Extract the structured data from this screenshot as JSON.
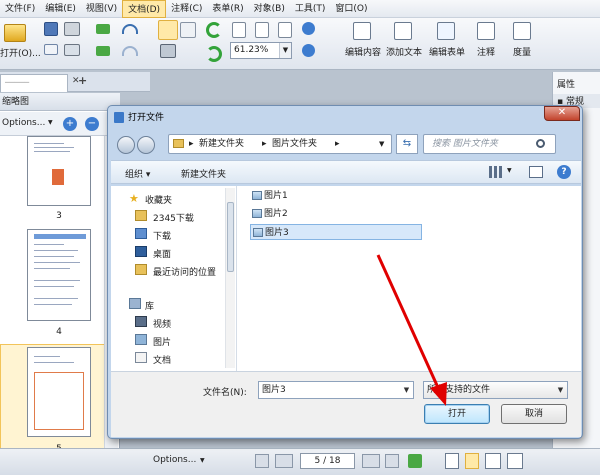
{
  "menu": [
    "文件(F)",
    "编辑(E)",
    "视图(V)",
    "文档(D)",
    "注释(C)",
    "表单(R)",
    "对象(B)",
    "工具(T)",
    "窗口(O)"
  ],
  "toolbar": {
    "open_label": "打开(O)...",
    "zoom_value": "61.23%",
    "edit_content": "编辑内容",
    "add_text": "添加文本",
    "edit_form": "编辑表单",
    "annotate": "注释",
    "measure": "度量"
  },
  "left_panel": {
    "title": "缩略图",
    "options": "Options...",
    "thumb_numbers": [
      "3",
      "4",
      "5"
    ]
  },
  "right_panel": {
    "header": "属性",
    "section": "常规"
  },
  "dialog": {
    "title": "打开文件",
    "breadcrumb": [
      "新建文件夹",
      "图片文件夹"
    ],
    "search_placeholder": "搜索 图片文件夹",
    "organize": "组织",
    "new_folder": "新建文件夹",
    "nav": {
      "favorites": "收藏夹",
      "items": [
        "2345下载",
        "下载",
        "桌面",
        "最近访问的位置"
      ],
      "library": "库",
      "library_items": [
        "视频",
        "图片",
        "文档"
      ]
    },
    "files": [
      "图片1",
      "图片2",
      "图片3"
    ],
    "filename_label": "文件名(N):",
    "filename_value": "图片3",
    "filetype_value": "所有支持的文件",
    "open_button": "打开",
    "cancel_button": "取消"
  },
  "bottom": {
    "options": "Options...",
    "page_current": "5",
    "page_total": "/ 18"
  },
  "colors": {
    "accent": "#3c7fb1",
    "selected": "#d7e8fa",
    "arrow": "#e00000",
    "close": "#c2432c"
  }
}
